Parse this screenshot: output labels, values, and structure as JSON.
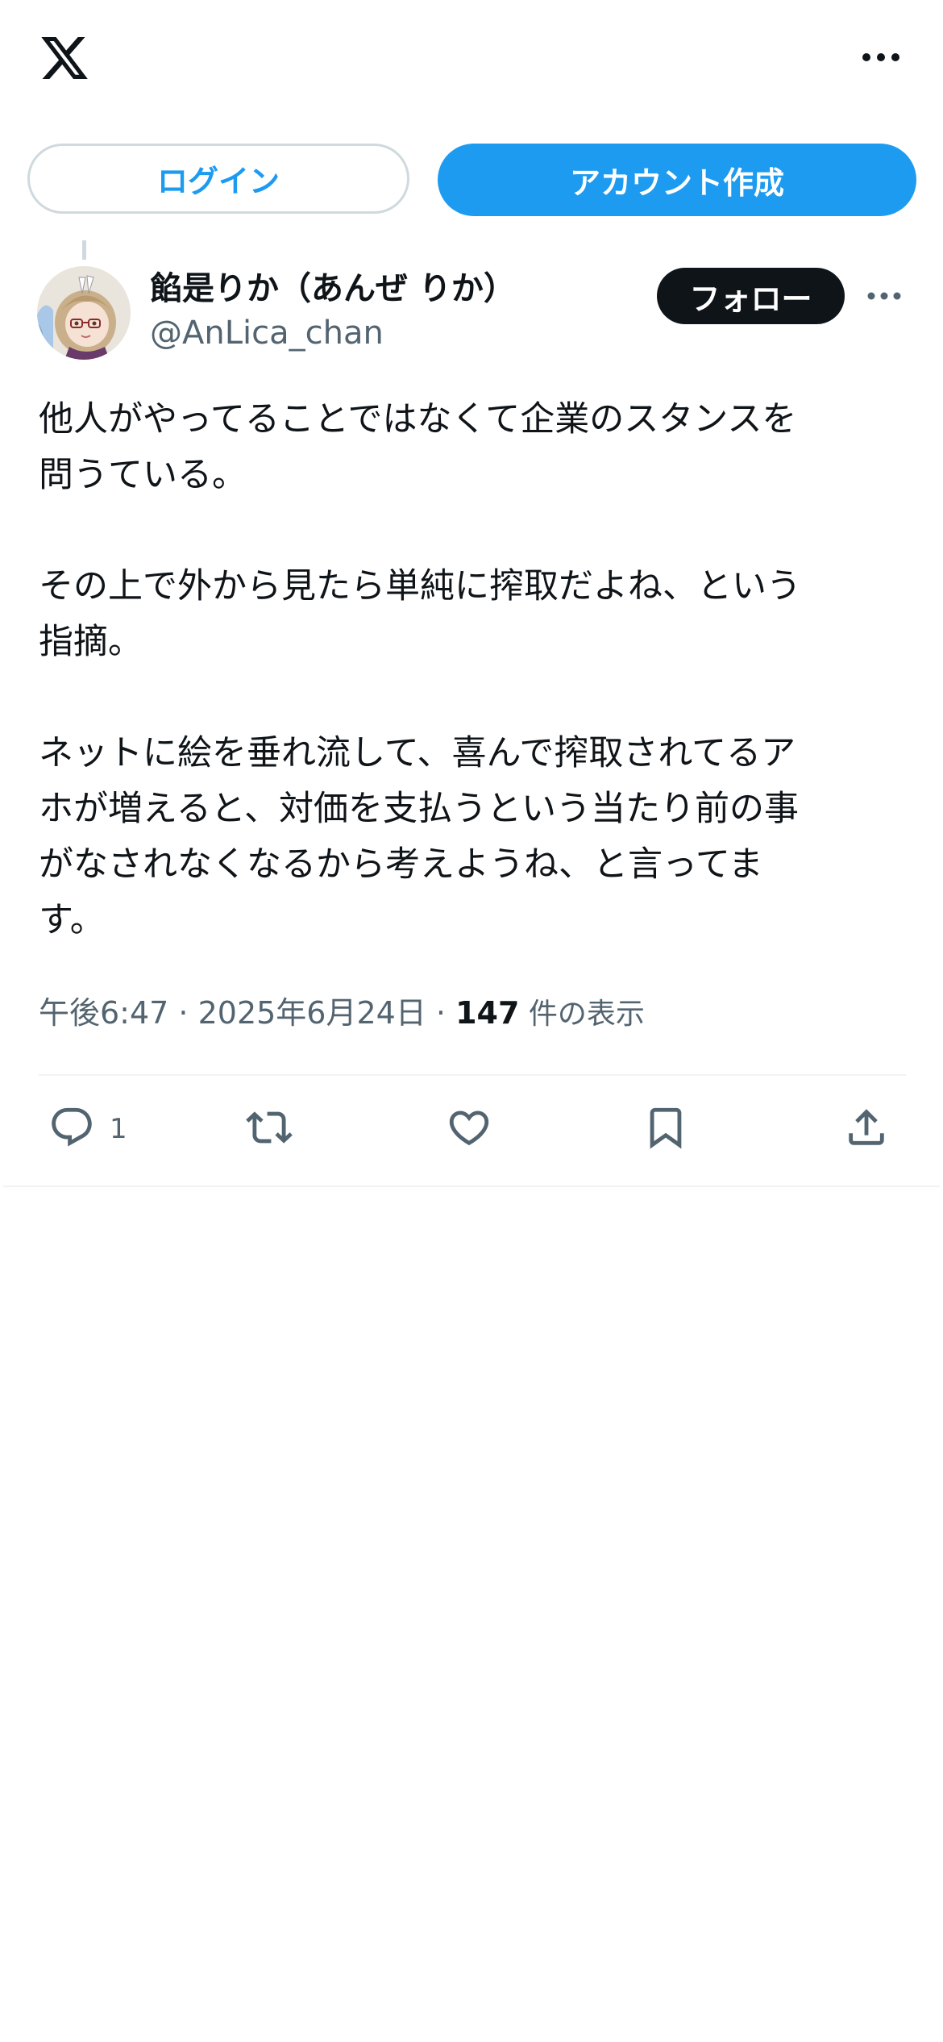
{
  "header": {
    "logo_icon": "x-logo-icon",
    "more_icon": "more-horizontal-icon"
  },
  "auth": {
    "login_label": "ログイン",
    "signup_label": "アカウント作成"
  },
  "tweet": {
    "author": {
      "display_name": "餡是りか（あんぜ りか）",
      "handle": "@AnLica_chan",
      "avatar_icon": "avatar-image"
    },
    "follow_label": "フォロー",
    "paragraphs": [
      "他人がやってることではなくて企業のスタンスを\n問うている。",
      "その上で外から見たら単純に搾取だよね、という\n指摘。",
      "ネットに絵を垂れ流して、喜んで搾取されてるア\nホが増えると、対価を支払うという当たり前の事\nがなされなくなるから考えようね、と言ってま\nす。"
    ],
    "time": "午後6:47",
    "separator": " · ",
    "date": "2025年6月24日",
    "views_count": "147",
    "views_label": " 件の表示",
    "actions": {
      "reply_count": "1",
      "reply_icon": "reply-bubble-icon",
      "retweet_icon": "retweet-icon",
      "like_icon": "heart-icon",
      "bookmark_icon": "bookmark-icon",
      "share_icon": "share-upload-icon"
    }
  },
  "colors": {
    "accent": "#1d9bf0",
    "text_primary": "#0f1419",
    "text_secondary": "#536471",
    "border": "#cfd9de"
  }
}
